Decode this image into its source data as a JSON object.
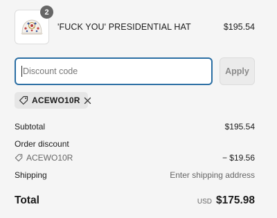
{
  "product": {
    "quantity": "2",
    "name": "'FUCK YOU' PRESIDENTIAL HAT",
    "price": "$195.54"
  },
  "discount": {
    "placeholder": "Discount code",
    "apply_label": "Apply"
  },
  "applied_code": {
    "code": "ACEWO10R"
  },
  "summary": {
    "subtotal_label": "Subtotal",
    "subtotal_value": "$195.54",
    "order_discount_label": "Order discount",
    "order_discount_code": "ACEWO10R",
    "order_discount_value": "− $19.56",
    "shipping_label": "Shipping",
    "shipping_value": "Enter shipping address",
    "total_label": "Total",
    "total_currency": "USD",
    "total_value": "$175.98"
  },
  "icons": {
    "tag": "tag-icon",
    "remove": "close-icon"
  },
  "colors": {
    "input_focus_border": "#2a6ea3",
    "quantity_badge": "#666666"
  }
}
